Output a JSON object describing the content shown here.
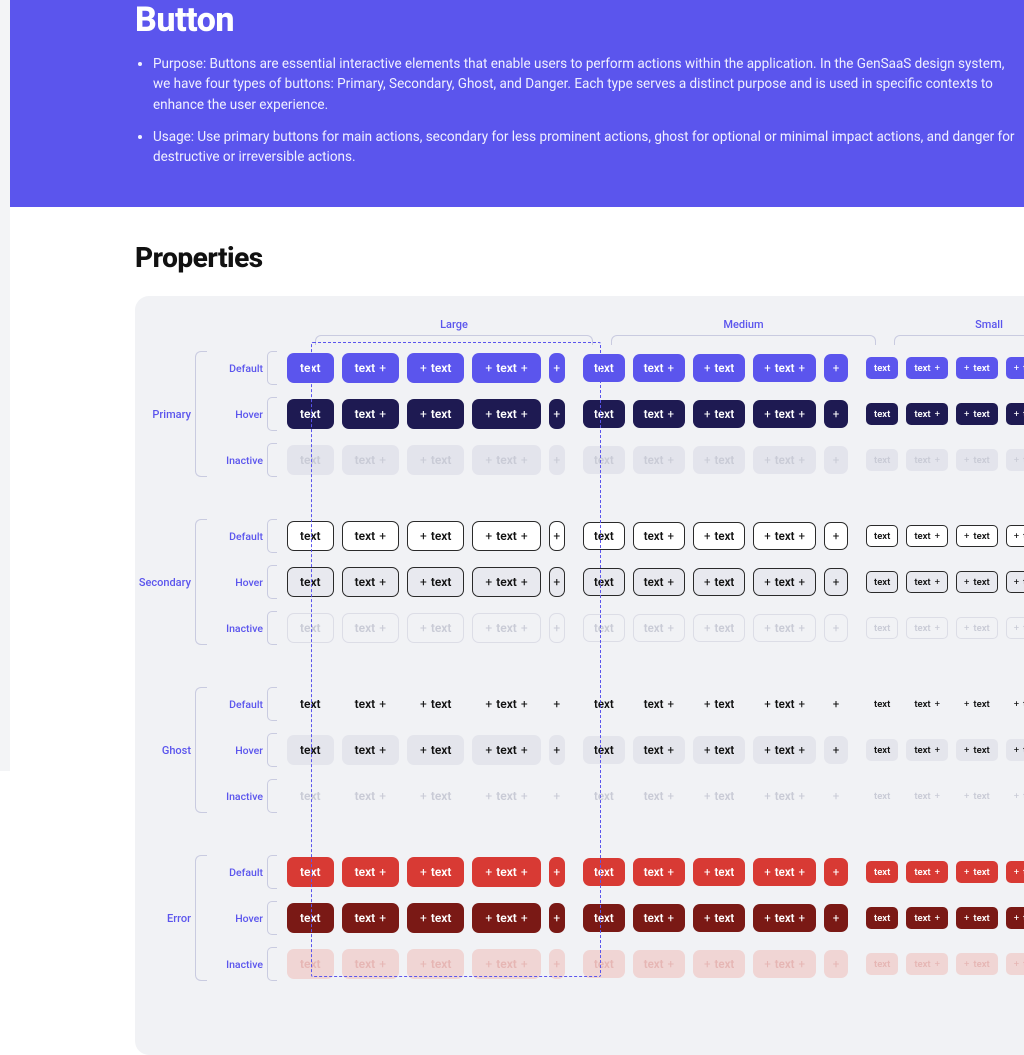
{
  "hero": {
    "title": "Button",
    "bullets": [
      "Purpose: Buttons are essential interactive elements that enable users to perform actions within the application. In the GenSaaS design system, we have four types of buttons: Primary, Secondary, Ghost, and Danger. Each type serves a distinct purpose and is used in specific contexts to enhance the user experience.",
      "Usage: Use primary buttons for main actions, secondary for less prominent actions, ghost for optional or minimal impact actions, and danger for destructive or irreversible actions."
    ]
  },
  "sections": {
    "properties": "Properties"
  },
  "sizes": {
    "large": "Large",
    "medium": "Medium",
    "small": "Small"
  },
  "variants": {
    "primary": "Primary",
    "secondary": "Secondary",
    "ghost": "Ghost",
    "error": "Error"
  },
  "states": {
    "default": "Default",
    "hover": "Hover",
    "inactive": "Inactive"
  },
  "button": {
    "label": "text",
    "icon_glyph": "+",
    "alt_icon_glyph": "×"
  },
  "colors": {
    "brand": "#5b55ed",
    "brand_hover": "#1e1a52",
    "danger": "#d83a34",
    "danger_hover": "#7a1915",
    "panel_bg": "#f1f2f5"
  },
  "compositions": [
    "text",
    "text-icon",
    "icon-text",
    "icon-text-icon",
    "icon-only"
  ]
}
